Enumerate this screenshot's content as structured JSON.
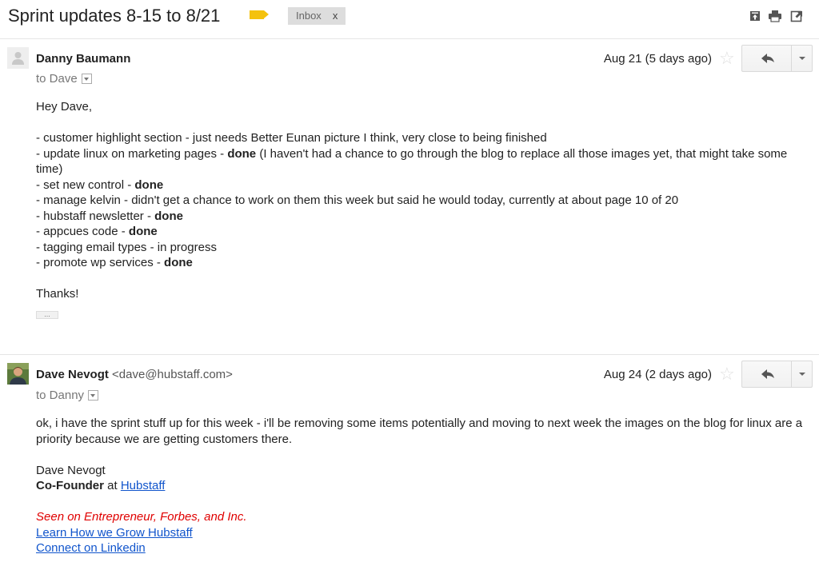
{
  "thread": {
    "subject": "Sprint updates 8-15 to 8/21",
    "label": "Inbox",
    "label_remove": "x",
    "label_color": "#f4c20d"
  },
  "toolbar": {
    "icons": [
      "expand-all-icon",
      "print-icon",
      "new-window-icon"
    ]
  },
  "messages": [
    {
      "sender_name": "Danny Baumann",
      "sender_email": "",
      "to": "to Dave",
      "date": "Aug 21 (5 days ago)",
      "greeting": "Hey Dave,",
      "lines": [
        {
          "text": "- customer highlight section - just needs Better Eunan picture I think, very close to being finished",
          "bold": ""
        },
        {
          "text": "- update linux on marketing pages - ",
          "bold": "done",
          "after": " (I haven't had a chance to go through the blog to replace all those images yet, that might take some time)"
        },
        {
          "text": "- set new control - ",
          "bold": "done"
        },
        {
          "text": "- manage kelvin - didn't get a chance to work on them this week but said he would today, currently at about page 10 of 20",
          "bold": ""
        },
        {
          "text": "- hubstaff newsletter - ",
          "bold": "done"
        },
        {
          "text": "- appcues code - ",
          "bold": "done"
        },
        {
          "text": "- tagging email types - in progress",
          "bold": ""
        },
        {
          "text": "- promote wp services - ",
          "bold": "done"
        }
      ],
      "closing": "Thanks!",
      "trimmed_content": "..."
    },
    {
      "sender_name": "Dave Nevogt",
      "sender_email": "<dave@hubstaff.com>",
      "to": "to Danny",
      "date": "Aug 24 (2 days ago)",
      "body": "ok, i have the sprint stuff up for this week - i'll be removing some items potentially and moving to next week the images on the blog for linux are a priority because we are getting customers there.",
      "signature": {
        "name": "Dave Nevogt",
        "title": "Co-Founder",
        "at": " at ",
        "company_link": "Hubstaff",
        "tagline": "Seen on Entrepreneur, Forbes, and Inc.",
        "link_grow": "Learn How we Grow Hubstaff",
        "link_linkedin": "Connect on Linkedin"
      }
    }
  ]
}
